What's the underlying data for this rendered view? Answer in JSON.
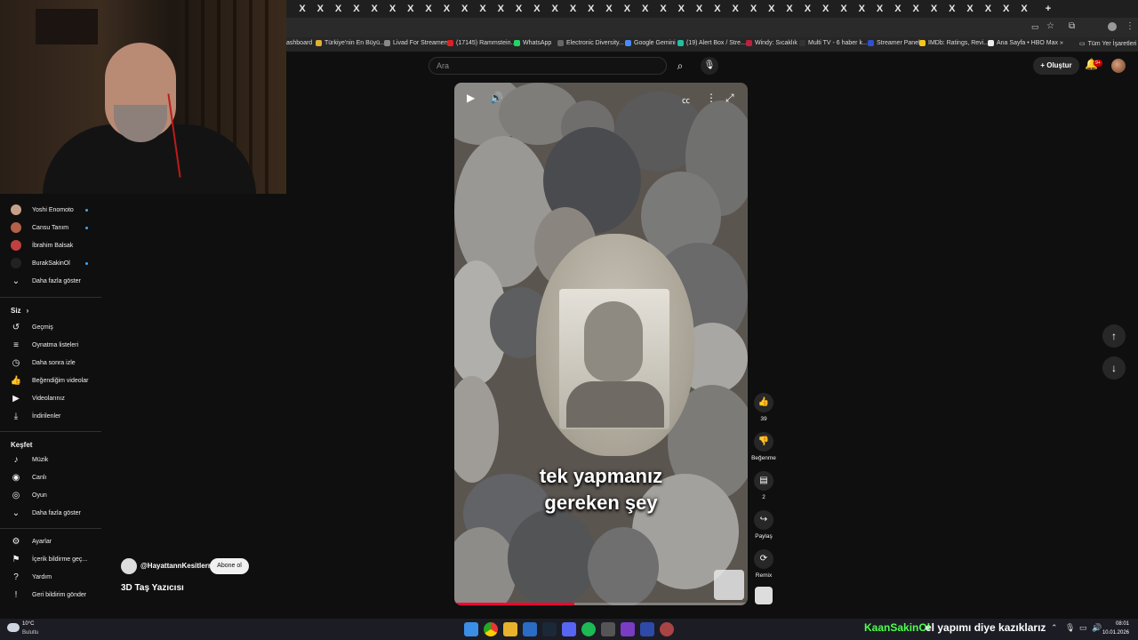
{
  "browser": {
    "tab_glyph": "X",
    "new_tab": "+",
    "bookmarks": [
      {
        "label": "ashboard",
        "color": "#444"
      },
      {
        "label": "Türkiye'nin En Büyü...",
        "color": "#e0b030"
      },
      {
        "label": "Livad For Streamers",
        "color": "#888"
      },
      {
        "label": "(17145) Rammstein...",
        "color": "#e02020"
      },
      {
        "label": "WhatsApp",
        "color": "#25d366"
      },
      {
        "label": "Electronic Diversity...",
        "color": "#666"
      },
      {
        "label": "Google Gemini",
        "color": "#4a8cff"
      },
      {
        "label": "(19) Alert Box / Stre...",
        "color": "#20c0a0"
      },
      {
        "label": "Windy: Sıcaklık",
        "color": "#c02040"
      },
      {
        "label": "Multi TV - 6 haber k...",
        "color": "#333"
      },
      {
        "label": "Streamer Panel",
        "color": "#3050d0"
      },
      {
        "label": "IMDb: Ratings, Revi...",
        "color": "#f5c518"
      },
      {
        "label": "Ana Sayfa • HBO Max",
        "color": "#eee"
      }
    ],
    "bookmarks_more": "»",
    "all_bookmarks": "Tüm Yer İşaretleri"
  },
  "header": {
    "search_placeholder": "Ara",
    "create_label": "Oluştur",
    "notifications_badge": "9+"
  },
  "sidebar": {
    "subscriptions": [
      {
        "name": "Yoshi Enomoto",
        "live": true,
        "color": "#c8a08a"
      },
      {
        "name": "Cansu Tanım",
        "live": true,
        "color": "#b5604a"
      },
      {
        "name": "İbrahim Balsak",
        "live": false,
        "color": "#c04040"
      },
      {
        "name": "BurakSakinOl",
        "live": true,
        "color": "#222222"
      }
    ],
    "show_more": "Daha fazla göster",
    "you_heading": "Siz",
    "you_chevron": "›",
    "you_items": [
      {
        "label": "Geçmiş",
        "icon": "↺",
        "icon_name": "history-icon"
      },
      {
        "label": "Oynatma listeleri",
        "icon": "≡",
        "icon_name": "playlists-icon"
      },
      {
        "label": "Daha sonra izle",
        "icon": "◷",
        "icon_name": "watch-later-icon"
      },
      {
        "label": "Beğendiğim videolar",
        "icon": "👍",
        "icon_name": "liked-videos-icon"
      },
      {
        "label": "Videolarınız",
        "icon": "▶",
        "icon_name": "your-videos-icon"
      },
      {
        "label": "İndirilenler",
        "icon": "⤓",
        "icon_name": "downloads-icon"
      }
    ],
    "explore_heading": "Keşfet",
    "explore_items": [
      {
        "label": "Müzik",
        "icon": "♪",
        "icon_name": "music-icon"
      },
      {
        "label": "Canlı",
        "icon": "◉",
        "icon_name": "live-icon"
      },
      {
        "label": "Oyun",
        "icon": "◎",
        "icon_name": "gaming-icon"
      },
      {
        "label": "Daha fazla göster",
        "icon": "⌄",
        "icon_name": "chevron-down-icon"
      }
    ],
    "settings_items": [
      {
        "label": "Ayarlar",
        "icon": "⚙",
        "icon_name": "settings-icon"
      },
      {
        "label": "İçerik bildirme geç...",
        "icon": "⚑",
        "icon_name": "report-history-icon"
      },
      {
        "label": "Yardım",
        "icon": "?",
        "icon_name": "help-icon"
      },
      {
        "label": "Geri bildirim gönder",
        "icon": "!",
        "icon_name": "feedback-icon"
      }
    ]
  },
  "video": {
    "caption_line1": "tek yapmanız",
    "caption_line2": "gereken şey",
    "progress": 0.41,
    "channel": "@HayattannKesitlerr",
    "subscribe_label": "Abone ol",
    "title": "3D Taş Yazıcısı"
  },
  "actions": {
    "likes": "39",
    "dislike_label": "Beğenme",
    "comments": "2",
    "share_label": "Paylaş",
    "remix_label": "Remix"
  },
  "taskbar": {
    "temp": "10°C",
    "weather": "Bulutlu",
    "ticker_user": "KaanSakinOl",
    "ticker_message": "el yapımı diye kazıklarız",
    "time": "08:01",
    "date": "10.01.2026"
  }
}
